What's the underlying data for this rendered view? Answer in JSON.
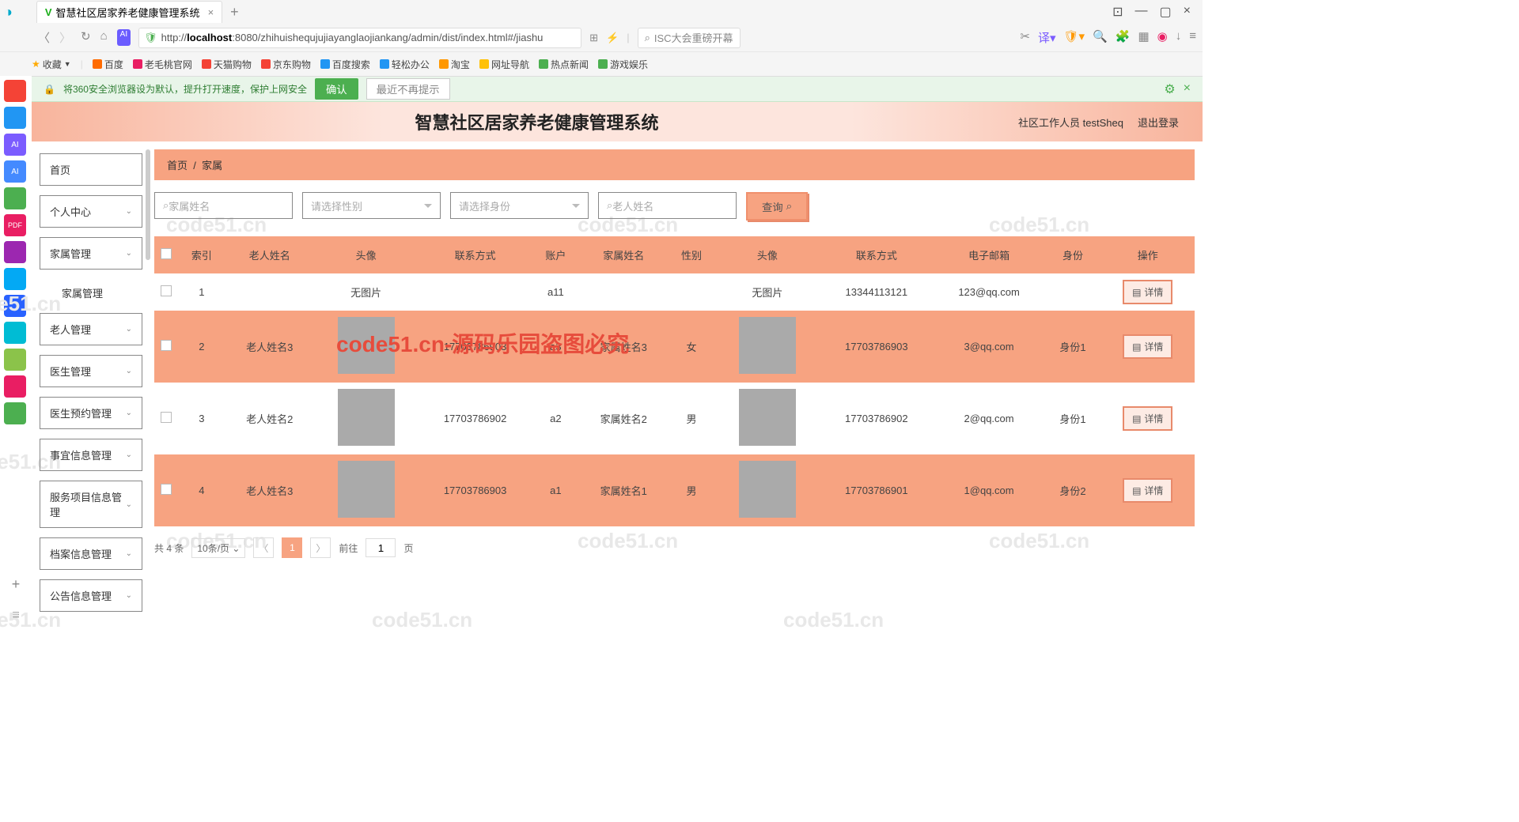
{
  "browser": {
    "tab_title": "智慧社区居家养老健康管理系统",
    "url_pre": "http://",
    "url_host": "localhost",
    "url_path": ":8080/zhihuishequjujiayanglaojiankang/admin/dist/index.html#/jiashu",
    "search_placeholder": "ISC大会重磅开幕",
    "bookmarks": [
      "收藏",
      "百度",
      "老毛桃官网",
      "天猫购物",
      "京东购物",
      "百度搜索",
      "轻松办公",
      "淘宝",
      "网址导航",
      "热点新闻",
      "游戏娱乐"
    ]
  },
  "notification": {
    "text": "将360安全浏览器设为默认，提升打开速度，保护上网安全",
    "confirm": "确认",
    "later": "最近不再提示"
  },
  "header": {
    "title": "智慧社区居家养老健康管理系统",
    "user_role": "社区工作人员",
    "user_name": "testSheq",
    "logout": "退出登录"
  },
  "sidebar": [
    {
      "label": "首页",
      "expandable": false
    },
    {
      "label": "个人中心",
      "expandable": true
    },
    {
      "label": "家属管理",
      "expandable": true
    },
    {
      "label": "家属管理",
      "expandable": false,
      "sub": true
    },
    {
      "label": "老人管理",
      "expandable": true
    },
    {
      "label": "医生管理",
      "expandable": true
    },
    {
      "label": "医生预约管理",
      "expandable": true
    },
    {
      "label": "事宜信息管理",
      "expandable": true
    },
    {
      "label": "服务项目信息管理",
      "expandable": true
    },
    {
      "label": "档案信息管理",
      "expandable": true
    },
    {
      "label": "公告信息管理",
      "expandable": true
    }
  ],
  "breadcrumb": {
    "home": "首页",
    "sep": "/",
    "current": "家属"
  },
  "search": {
    "name_ph": "家属姓名",
    "gender_ph": "请选择性别",
    "identity_ph": "请选择身份",
    "elder_ph": "老人姓名",
    "query": "查询"
  },
  "table": {
    "headers": [
      "",
      "索引",
      "老人姓名",
      "头像",
      "联系方式",
      "账户",
      "家属姓名",
      "性别",
      "头像",
      "联系方式",
      "电子邮箱",
      "身份",
      "操作"
    ],
    "no_image": "无图片",
    "detail": "详情",
    "rows": [
      {
        "idx": "1",
        "elder": "",
        "avatar1": "无图片",
        "phone1": "",
        "account": "a11",
        "fname": "",
        "gender": "",
        "avatar2": "无图片",
        "phone2": "13344113121",
        "email": "123@qq.com",
        "identity": ""
      },
      {
        "idx": "2",
        "elder": "老人姓名3",
        "avatar1": "img",
        "phone1": "17703786903",
        "account": "a3",
        "fname": "家属姓名3",
        "gender": "女",
        "avatar2": "img",
        "phone2": "17703786903",
        "email": "3@qq.com",
        "identity": "身份1"
      },
      {
        "idx": "3",
        "elder": "老人姓名2",
        "avatar1": "img",
        "phone1": "17703786902",
        "account": "a2",
        "fname": "家属姓名2",
        "gender": "男",
        "avatar2": "img",
        "phone2": "17703786902",
        "email": "2@qq.com",
        "identity": "身份1"
      },
      {
        "idx": "4",
        "elder": "老人姓名3",
        "avatar1": "img",
        "phone1": "17703786903",
        "account": "a1",
        "fname": "家属姓名1",
        "gender": "男",
        "avatar2": "img",
        "phone2": "17703786901",
        "email": "1@qq.com",
        "identity": "身份2"
      }
    ]
  },
  "pagination": {
    "total": "共 4 条",
    "perpage": "10条/页",
    "current": "1",
    "goto": "前往",
    "goto_val": "1",
    "page": "页"
  },
  "watermark": "code51.cn",
  "redmark": "code51.cn-源码乐园盗图必究"
}
